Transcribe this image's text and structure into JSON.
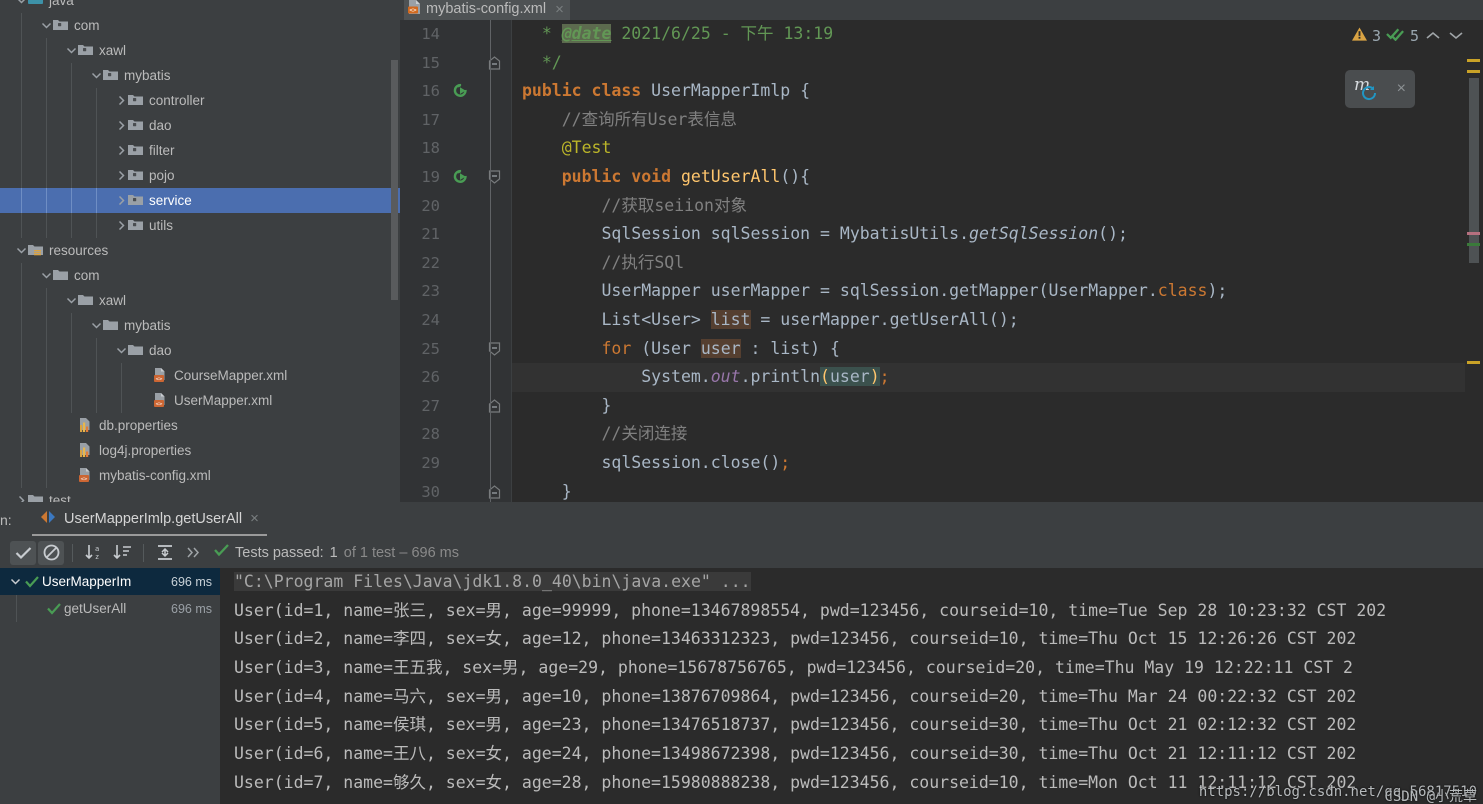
{
  "project_tree": {
    "rows": [
      {
        "label": "java",
        "indent": 1,
        "twisty": "down",
        "icon": "source-folder-icon",
        "selected": false,
        "cut_top": true
      },
      {
        "label": "com",
        "indent": 2,
        "twisty": "down",
        "icon": "package-folder-icon",
        "selected": false
      },
      {
        "label": "xawl",
        "indent": 3,
        "twisty": "down",
        "icon": "package-folder-icon",
        "selected": false
      },
      {
        "label": "mybatis",
        "indent": 4,
        "twisty": "down",
        "icon": "package-folder-icon",
        "selected": false
      },
      {
        "label": "controller",
        "indent": 5,
        "twisty": "right",
        "icon": "package-folder-icon",
        "selected": false
      },
      {
        "label": "dao",
        "indent": 5,
        "twisty": "right",
        "icon": "package-folder-icon",
        "selected": false
      },
      {
        "label": "filter",
        "indent": 5,
        "twisty": "right",
        "icon": "package-folder-icon",
        "selected": false
      },
      {
        "label": "pojo",
        "indent": 5,
        "twisty": "right",
        "icon": "package-folder-icon",
        "selected": false
      },
      {
        "label": "service",
        "indent": 5,
        "twisty": "right",
        "icon": "package-folder-icon",
        "selected": true
      },
      {
        "label": "utils",
        "indent": 5,
        "twisty": "right",
        "icon": "package-folder-icon",
        "selected": false
      },
      {
        "label": "resources",
        "indent": 1,
        "twisty": "down",
        "icon": "resource-folder-icon",
        "selected": false
      },
      {
        "label": "com",
        "indent": 2,
        "twisty": "down",
        "icon": "folder-icon",
        "selected": false
      },
      {
        "label": "xawl",
        "indent": 3,
        "twisty": "down",
        "icon": "folder-icon",
        "selected": false
      },
      {
        "label": "mybatis",
        "indent": 4,
        "twisty": "down",
        "icon": "folder-icon",
        "selected": false
      },
      {
        "label": "dao",
        "indent": 5,
        "twisty": "down",
        "icon": "folder-icon",
        "selected": false
      },
      {
        "label": "CourseMapper.xml",
        "indent": 6,
        "twisty": "none",
        "icon": "xml-file-icon",
        "selected": false
      },
      {
        "label": "UserMapper.xml",
        "indent": 6,
        "twisty": "none",
        "icon": "xml-file-icon",
        "selected": false
      },
      {
        "label": "db.properties",
        "indent": 3,
        "twisty": "none",
        "icon": "properties-file-icon",
        "selected": false
      },
      {
        "label": "log4j.properties",
        "indent": 3,
        "twisty": "none",
        "icon": "properties-file-icon",
        "selected": false
      },
      {
        "label": "mybatis-config.xml",
        "indent": 3,
        "twisty": "none",
        "icon": "xml-file-icon",
        "selected": false
      },
      {
        "label": "test",
        "indent": 1,
        "twisty": "right",
        "icon": "folder-icon",
        "selected": false,
        "cut_bottom": true
      }
    ]
  },
  "editor": {
    "tab": {
      "title": "mybatis-config.xml",
      "icon": "xml-file-icon",
      "close": "×"
    },
    "inspections": {
      "warning_icon": "warning-triangle-icon",
      "warning_count": "3",
      "ok_icon": "double-check-icon",
      "ok_count": "5",
      "prev_icon": "chevron-up-icon",
      "next_icon": "chevron-down-icon"
    },
    "mybatis_widget": {
      "logo": "m",
      "badge_icon": "refresh-icon",
      "close": "×"
    },
    "line_numbers": [
      "14",
      "15",
      "16",
      "17",
      "18",
      "19",
      "20",
      "21",
      "22",
      "23",
      "24",
      "25",
      "26",
      "27",
      "28",
      "29",
      "30"
    ],
    "lines": [
      {
        "n": "14",
        "indent": 0,
        "kind": "javadoc",
        "parts": [
          {
            "t": "  * ",
            "c": "doc"
          },
          {
            "t": "@date",
            "c": "tag hl-doc"
          },
          {
            "t": " 2021/6/25 - 下午 13:19",
            "c": "doc"
          }
        ]
      },
      {
        "n": "15",
        "fold": "end-doc",
        "parts": [
          {
            "t": "  */",
            "c": "doc"
          }
        ]
      },
      {
        "n": "16",
        "gutter": "run-test-icon",
        "parts": [
          {
            "t": "public ",
            "c": "kb"
          },
          {
            "t": "class ",
            "c": "kb"
          },
          {
            "t": "UserMapperImlp",
            "c": "txt"
          },
          {
            "t": " {",
            "c": "txt"
          }
        ]
      },
      {
        "n": "17",
        "parts": [
          {
            "t": "    //查询所有User表信息",
            "c": "cm"
          }
        ]
      },
      {
        "n": "18",
        "parts": [
          {
            "t": "    @Test",
            "c": "ann"
          }
        ]
      },
      {
        "n": "19",
        "gutter": "run-test-icon",
        "fold": "open",
        "parts": [
          {
            "t": "    ",
            "c": "txt"
          },
          {
            "t": "public ",
            "c": "kb"
          },
          {
            "t": "void ",
            "c": "kb"
          },
          {
            "t": "getUserAll",
            "c": "mth"
          },
          {
            "t": "(){",
            "c": "txt"
          }
        ]
      },
      {
        "n": "20",
        "caret": true,
        "parts": [
          {
            "t": "        //获取seiion对象",
            "c": "cm"
          }
        ]
      },
      {
        "n": "21",
        "parts": [
          {
            "t": "        SqlSession sqlSession = MybatisUtils.",
            "c": "txt"
          },
          {
            "t": "getSqlSession",
            "c": "stm"
          },
          {
            "t": "();",
            "c": "txt"
          }
        ]
      },
      {
        "n": "22",
        "parts": [
          {
            "t": "        //执行SQl",
            "c": "cm"
          }
        ]
      },
      {
        "n": "23",
        "parts": [
          {
            "t": "        UserMapper userMapper = sqlSession.getMapper(UserMapper.",
            "c": "txt"
          },
          {
            "t": "class",
            "c": "k"
          },
          {
            "t": ");",
            "c": "txt"
          }
        ]
      },
      {
        "n": "24",
        "parts": [
          {
            "t": "        List<User> ",
            "c": "txt"
          },
          {
            "t": "list",
            "c": "txt hl-ident"
          },
          {
            "t": " = userMapper.getUserAll();",
            "c": "txt"
          }
        ]
      },
      {
        "n": "25",
        "fold": "open",
        "parts": [
          {
            "t": "        ",
            "c": "txt"
          },
          {
            "t": "for ",
            "c": "k"
          },
          {
            "t": "(User ",
            "c": "txt"
          },
          {
            "t": "user",
            "c": "txt hl-ident"
          },
          {
            "t": " : list) {",
            "c": "txt"
          }
        ]
      },
      {
        "n": "26",
        "caretline": true,
        "parts": [
          {
            "t": "            System.",
            "c": "txt"
          },
          {
            "t": "out",
            "c": "sfld"
          },
          {
            "t": ".println",
            "c": "txt"
          },
          {
            "t": "(",
            "c": "kw-paren hl-paren"
          },
          {
            "t": "user",
            "c": "txt hl-paren"
          },
          {
            "t": ")",
            "c": "kw-paren hl-paren"
          },
          {
            "t": ";",
            "c": "k"
          }
        ]
      },
      {
        "n": "27",
        "fold": "end",
        "parts": [
          {
            "t": "        }",
            "c": "txt"
          }
        ]
      },
      {
        "n": "28",
        "parts": [
          {
            "t": "        //关闭连接",
            "c": "cm"
          }
        ]
      },
      {
        "n": "29",
        "parts": [
          {
            "t": "        sqlSession.close()",
            "c": "txt"
          },
          {
            "t": ";",
            "c": "k"
          }
        ]
      },
      {
        "n": "30",
        "fold": "end",
        "parts": [
          {
            "t": "    }",
            "c": "txt"
          }
        ]
      }
    ]
  },
  "run_window": {
    "label": "n:",
    "tab": {
      "icon": "run-config-icon",
      "title": "UserMapperImlp.getUserAll",
      "close": "×"
    },
    "toolbar": {
      "buttons": [
        {
          "name": "show-passed-toggle",
          "icon": "check-icon",
          "active": true
        },
        {
          "name": "hide-ignored-toggle",
          "icon": "no-entry-icon",
          "active": true
        },
        {
          "name": "sort-alphabetically-button",
          "icon": "sort-alpha-icon",
          "active": false
        },
        {
          "name": "sort-by-duration-button",
          "icon": "sort-list-icon",
          "active": false
        },
        {
          "name": "expand-collapse-button",
          "icon": "expand-collapse-icon",
          "active": false
        },
        {
          "name": "more-options-button",
          "icon": "chevrons-right-icon",
          "active": false
        }
      ],
      "status_icon": "green-check-icon",
      "status_main": "Tests passed:",
      "status_count": "1",
      "status_suffix": "of 1 test – 696 ms"
    },
    "tests": [
      {
        "label": "UserMapperIm",
        "duration": "696 ms",
        "icon": "green-check-icon",
        "twisty": "down",
        "indent": 0,
        "selected": true
      },
      {
        "label": "getUserAll",
        "duration": "696 ms",
        "icon": "green-check-icon",
        "twisty": "none",
        "indent": 1,
        "selected": false
      }
    ],
    "console": [
      {
        "kind": "command",
        "text": "\"C:\\Program Files\\Java\\jdk1.8.0_40\\bin\\java.exe\" ..."
      },
      {
        "kind": "out",
        "text": "User(id=1, name=张三, sex=男, age=99999, phone=13467898554, pwd=123456, courseid=10, time=Tue Sep 28 10:23:32 CST 202"
      },
      {
        "kind": "out",
        "text": "User(id=2, name=李四, sex=女, age=12, phone=13463312323, pwd=123456, courseid=10, time=Thu Oct 15 12:26:26 CST 202"
      },
      {
        "kind": "out",
        "text": "User(id=3, name=王五我, sex=男, age=29, phone=15678756765, pwd=123456, courseid=20, time=Thu May 19 12:22:11 CST 2"
      },
      {
        "kind": "out",
        "text": "User(id=4, name=马六, sex=男, age=10, phone=13876709864, pwd=123456, courseid=20, time=Thu Mar 24 00:22:32 CST 202"
      },
      {
        "kind": "out",
        "text": "User(id=5, name=侯琪, sex=男, age=23, phone=13476518737, pwd=123456, courseid=30, time=Thu Oct 21 02:12:32 CST 202"
      },
      {
        "kind": "out",
        "text": "User(id=6, name=王八, sex=女, age=24, phone=13498672398, pwd=123456, courseid=30, time=Thu Oct 21 12:11:12 CST 202"
      },
      {
        "kind": "out",
        "text": "User(id=7, name=够久, sex=女, age=28, phone=15980888238, pwd=123456, courseid=10, time=Mon Oct 11 12:11:12 CST 202"
      }
    ],
    "watermark_line1": "https://blog.csdn.net/qq_56817510",
    "watermark_line2": "CSDN @小荒草"
  },
  "colors": {
    "selection_blue": "#4b6eaf",
    "panel_bg": "#3c3f41",
    "editor_bg": "#2b2b2b",
    "accent_green": "#499c54",
    "warning_yellow": "#d9a343"
  }
}
